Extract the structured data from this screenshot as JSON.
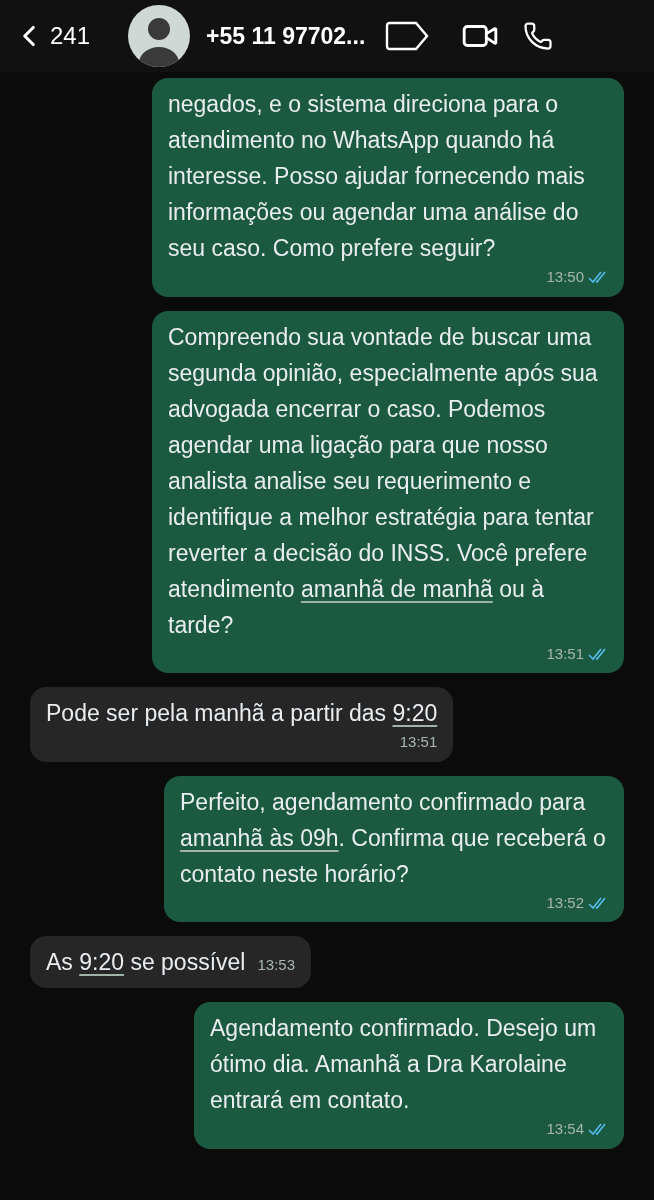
{
  "header": {
    "back_count": "241",
    "contact": "+55 11 97702..."
  },
  "messages": [
    {
      "kind": "sent",
      "parts": [
        {
          "text": "negados, e o sistema direciona para o atendimento no WhatsApp quando há interesse. Posso ajudar fornecendo mais informações ou agendar uma análise do seu caso. Como prefere seguir?",
          "link": false
        }
      ],
      "time": "13:50",
      "read": true,
      "inline_time": false
    },
    {
      "kind": "sent",
      "parts": [
        {
          "text": "Compreendo sua vontade de buscar uma segunda opinião, especialmente após sua advogada encerrar o caso. Podemos agendar uma ligação para que nosso analista analise seu requerimento e identifique a melhor estratégia para tentar reverter a decisão do INSS. Você prefere atendimento ",
          "link": false
        },
        {
          "text": "amanhã de manhã",
          "link": true
        },
        {
          "text": " ou à tarde?",
          "link": false
        }
      ],
      "time": "13:51",
      "read": true,
      "inline_time": false
    },
    {
      "kind": "received",
      "parts": [
        {
          "text": "Pode ser pela manhã a partir das ",
          "link": false
        },
        {
          "text": "9:20",
          "link": true
        }
      ],
      "time": "13:51",
      "inline_time": false
    },
    {
      "kind": "sent",
      "parts": [
        {
          "text": "Perfeito, agendamento confirmado para ",
          "link": false
        },
        {
          "text": "amanhã às 09h",
          "link": true
        },
        {
          "text": ". Confirma que receberá o contato neste horário?",
          "link": false
        }
      ],
      "time": "13:52",
      "read": true,
      "inline_time": false
    },
    {
      "kind": "received",
      "parts": [
        {
          "text": "As ",
          "link": false
        },
        {
          "text": "9:20",
          "link": true
        },
        {
          "text": " se possível",
          "link": false
        }
      ],
      "time": "13:53",
      "inline_time": true
    },
    {
      "kind": "sent",
      "parts": [
        {
          "text": "Agendamento confirmado. Desejo um ótimo dia. Amanhã a Dra Karolaine entrará em contato.",
          "link": false
        }
      ],
      "time": "13:54",
      "read": true,
      "inline_time": false
    }
  ]
}
